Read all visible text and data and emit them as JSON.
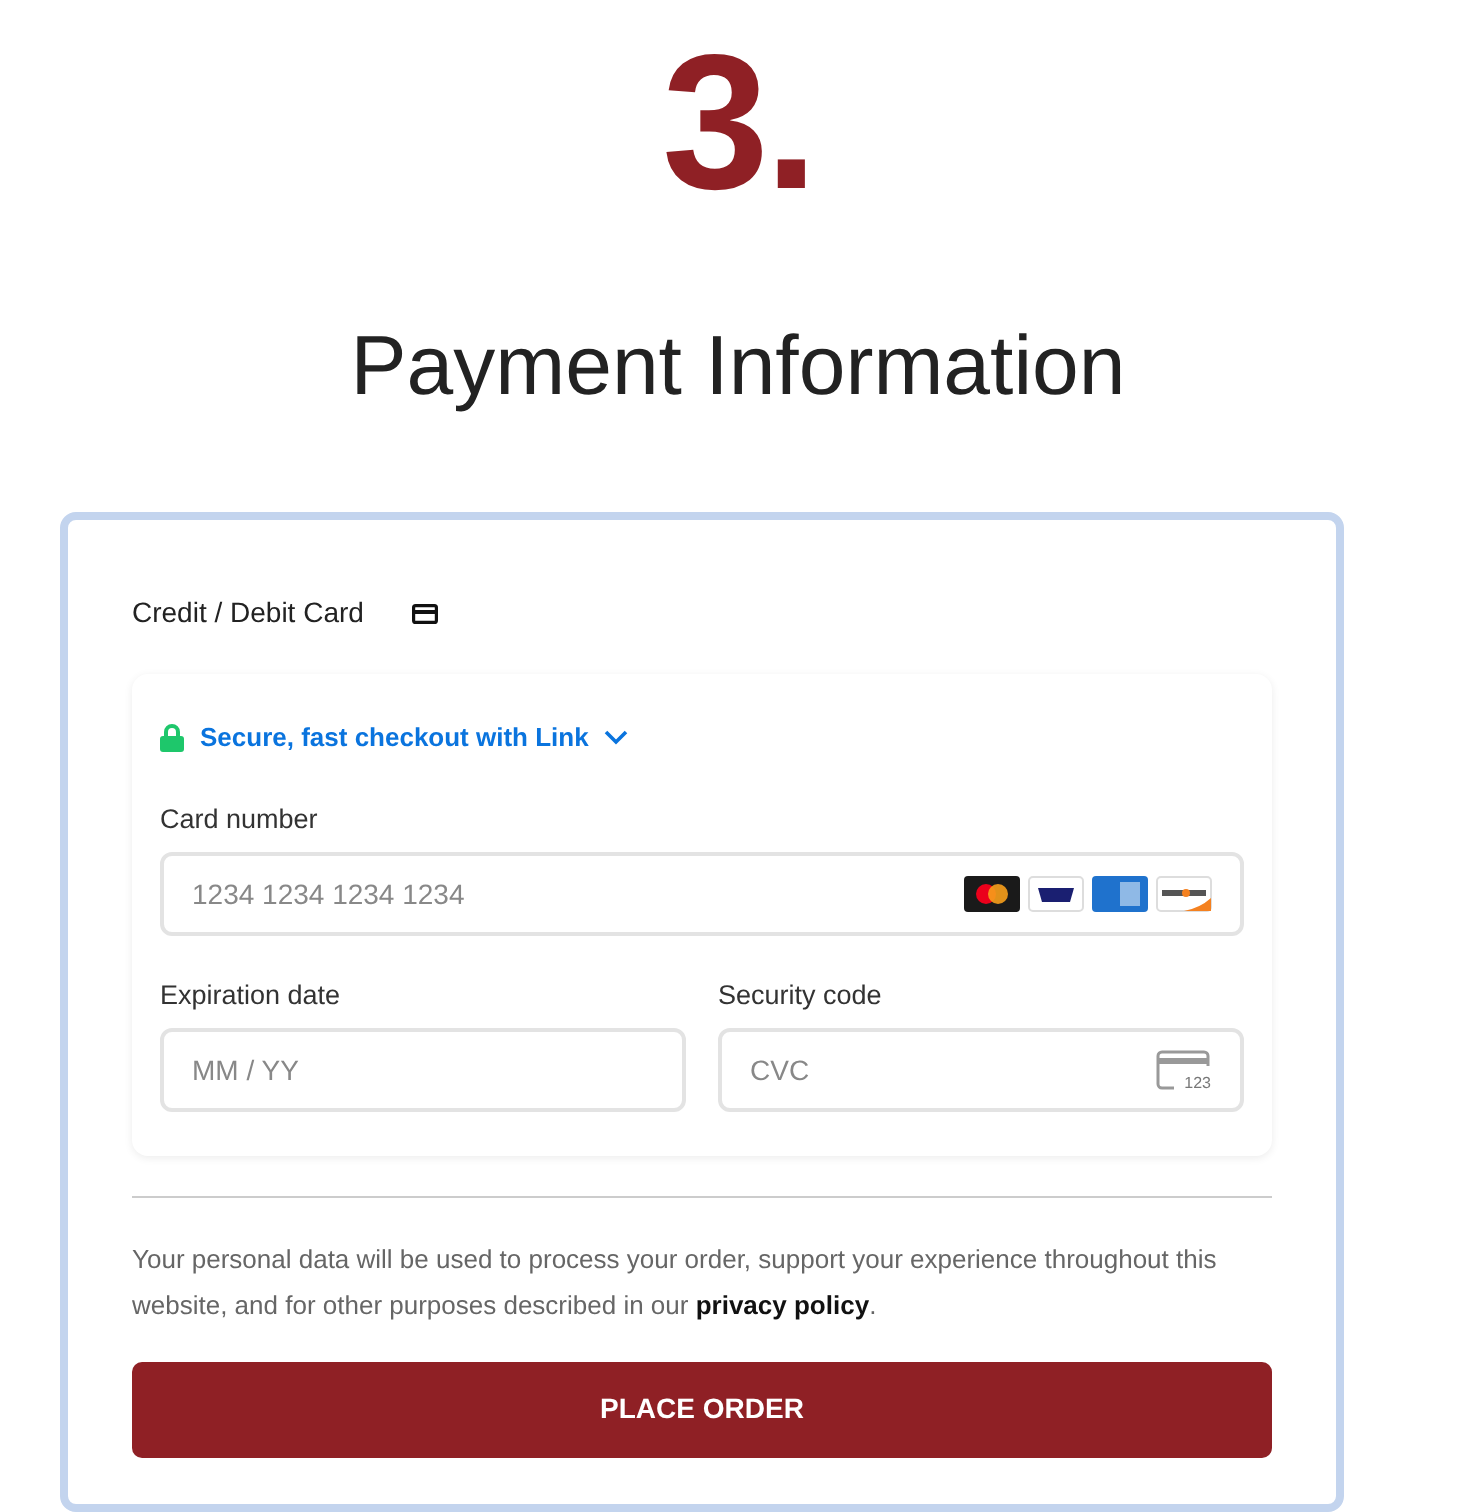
{
  "step_number": "3.",
  "heading": "Payment Information",
  "payment_method": {
    "label": "Credit / Debit Card"
  },
  "link_banner": {
    "text": "Secure, fast checkout with Link",
    "expanded": false
  },
  "card_number": {
    "label": "Card number",
    "placeholder": "1234 1234 1234 1234"
  },
  "expiration": {
    "label": "Expiration date",
    "placeholder": "MM / YY"
  },
  "security_code": {
    "label": "Security code",
    "placeholder": "CVC",
    "icon_text": "123"
  },
  "privacy_notice": {
    "before": "Your personal data will be used to process your order, support your experience throughout this website, and for other purposes described in our ",
    "link": "privacy policy",
    "after": "."
  },
  "button": "PLACE ORDER"
}
